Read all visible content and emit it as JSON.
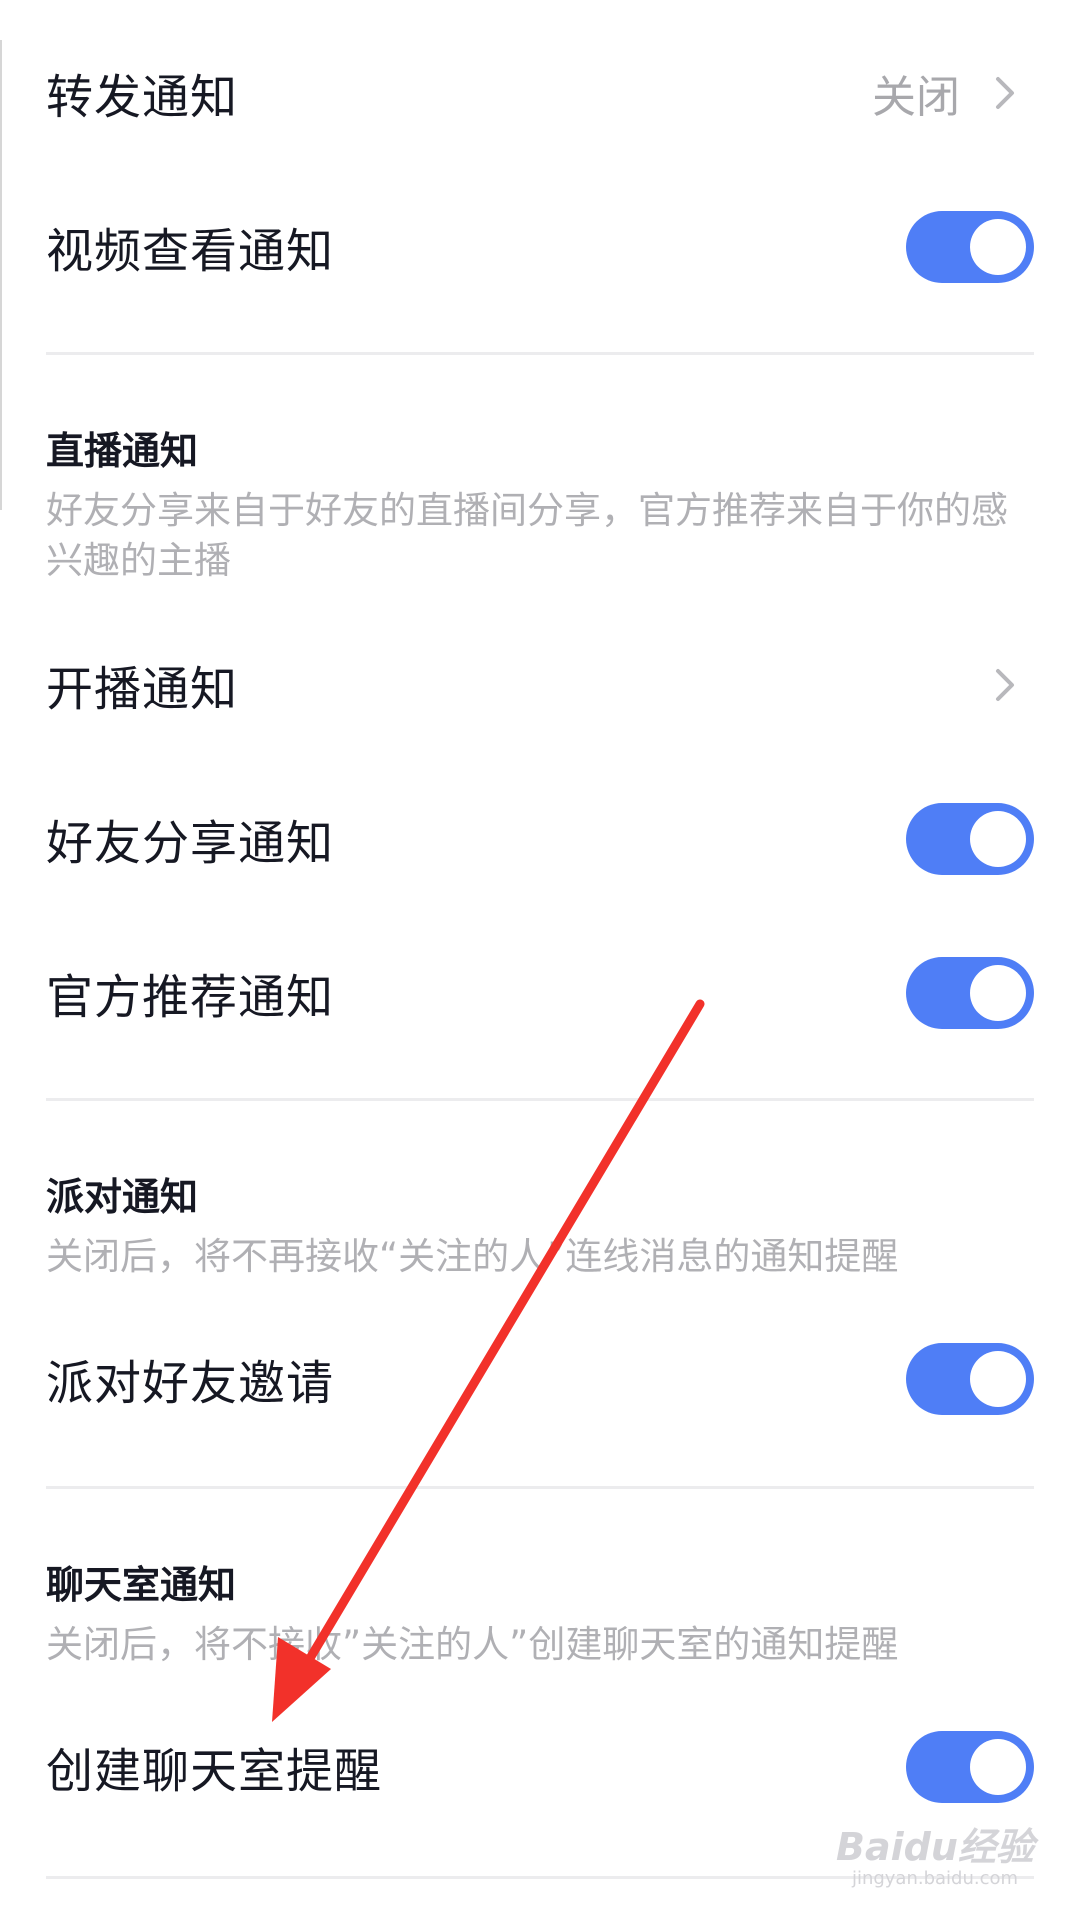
{
  "rows": [
    {
      "label": "转发通知",
      "value": "关闭"
    },
    {
      "label": "视频查看通知"
    },
    {
      "label": "开播通知"
    },
    {
      "label": "好友分享通知"
    },
    {
      "label": "官方推荐通知"
    },
    {
      "label": "派对好友邀请"
    },
    {
      "label": "创建聊天室提醒"
    }
  ],
  "toggles": {
    "video_view_notice": "on",
    "friend_share_notice": "on",
    "official_recommend_notice": "on",
    "party_friend_invite": "on",
    "create_chatroom_reminder": "on"
  },
  "sections": {
    "live": {
      "title": "直播通知",
      "desc": "好友分享来自于好友的直播间分享，官方推荐来自于你的感兴趣的主播"
    },
    "party": {
      "title": "派对通知",
      "desc": "关闭后，将不再接收“关注的人”连线消息的通知提醒"
    },
    "chatroom": {
      "title": "聊天室通知",
      "desc": "关闭后，将不接收”关注的人”创建聊天室的通知提醒"
    }
  },
  "icons": {
    "chevron": "chevron-right-icon",
    "annotation": "red-arrow-annotation"
  },
  "watermark": {
    "main": "Baidu经验",
    "sub": "jingyan.baidu.com"
  },
  "colors": {
    "toggle_on": "#4f7ef6",
    "annotation_arrow": "#f2312a",
    "primary_text": "#161823",
    "secondary_text": "#a8a8ac"
  }
}
